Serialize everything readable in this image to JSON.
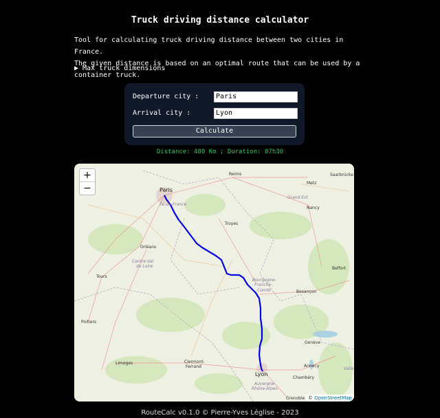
{
  "header": {
    "title": "Truck driving distance calculator"
  },
  "intro": {
    "line1": "Tool for calculating truck driving distance between two cities in France.",
    "line2": "The given distance is based on an optimal route that can be used by a",
    "line3": "container truck."
  },
  "details": {
    "summary": "▶ Max truck dimensions"
  },
  "form": {
    "departure_label": "Departure city :",
    "departure_value": "Paris",
    "arrival_label": "Arrival city :",
    "arrival_value": "Lyon",
    "calculate_label": "Calculate"
  },
  "result": {
    "text": "Distance: 480 Km ; Duration: 07h30"
  },
  "map": {
    "zoom_in": "+",
    "zoom_out": "−",
    "attribution_prefix": "© ",
    "attribution_link": "OpenStreetMap",
    "route_color": "#0000ee",
    "cities": {
      "reims": "Reims",
      "saarbrucken": "Saarbrücke",
      "metz": "Metz",
      "paris": "Paris",
      "grand_est": "Grand Est",
      "nancy": "Nancy",
      "ile_de_france": "Île-de-France",
      "troyes": "Troyes",
      "orleans": "Orléans",
      "centre_val": "Centre-Val",
      "de_loire": "de Loire",
      "belfort": "Belfort",
      "tours": "Tours",
      "bourgogne": "Bourgogne-",
      "franche": "Franche-",
      "comte": "Comté",
      "besancon": "Besançon",
      "poitiers": "Poitiers",
      "geneve": "Genève",
      "limoges": "Limoges",
      "clermont": "Clermont-",
      "ferrand": "Ferrand",
      "annecy": "Annecy",
      "lyon": "Lyon",
      "chambery": "Chambéry",
      "auvergne": "Auvergne-",
      "rhone_alpes": "Rhône-Alpes",
      "grenoble": "Grenoble",
      "valle": "Valle"
    }
  },
  "footer": {
    "text": "RouteCalc v0.1.0 © Pierre-Yves Léglise - 2023"
  }
}
